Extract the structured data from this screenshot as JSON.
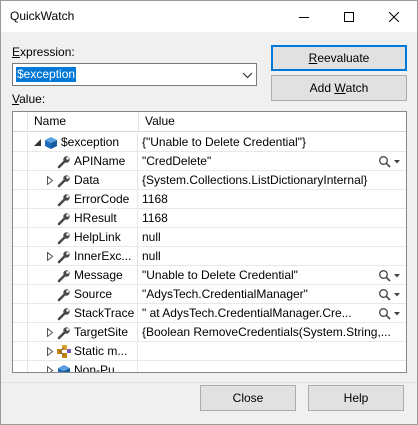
{
  "window": {
    "title": "QuickWatch"
  },
  "expression": {
    "label_prefix": "",
    "label_access": "E",
    "label_rest": "xpression:",
    "value": "$exception"
  },
  "value_label": {
    "access": "V",
    "rest": "alue:"
  },
  "buttons": {
    "reevaluate": {
      "access": "R",
      "rest": "eevaluate"
    },
    "add_watch": {
      "pre": "Add ",
      "access": "W",
      "rest": "atch"
    },
    "close": "Close",
    "help": "Help"
  },
  "grid": {
    "columns": [
      "Name",
      "Value"
    ],
    "rows": [
      {
        "name": "$exception",
        "value": "{\"Unable to Delete Credential\"}",
        "icon": "exception-object-icon",
        "expander": "expanded",
        "indent": 0,
        "visualizer": false
      },
      {
        "name": "APIName",
        "value": "\"CredDelete\"",
        "icon": "wrench-property-icon",
        "expander": "none",
        "indent": 1,
        "visualizer": true
      },
      {
        "name": "Data",
        "value": "{System.Collections.ListDictionaryInternal}",
        "icon": "wrench-property-icon",
        "expander": "collapsed",
        "indent": 1,
        "visualizer": false
      },
      {
        "name": "ErrorCode",
        "value": "1168",
        "icon": "wrench-property-icon",
        "expander": "none",
        "indent": 1,
        "visualizer": false
      },
      {
        "name": "HResult",
        "value": "1168",
        "icon": "wrench-property-icon",
        "expander": "none",
        "indent": 1,
        "visualizer": false
      },
      {
        "name": "HelpLink",
        "value": "null",
        "icon": "wrench-property-icon",
        "expander": "none",
        "indent": 1,
        "visualizer": false
      },
      {
        "name": "InnerExc...",
        "value": "null",
        "icon": "wrench-property-icon",
        "expander": "collapsed",
        "indent": 1,
        "visualizer": false
      },
      {
        "name": "Message",
        "value": "\"Unable to Delete Credential\"",
        "icon": "wrench-property-icon",
        "expander": "none",
        "indent": 1,
        "visualizer": true
      },
      {
        "name": "Source",
        "value": "\"AdysTech.CredentialManager\"",
        "icon": "wrench-property-icon",
        "expander": "none",
        "indent": 1,
        "visualizer": true
      },
      {
        "name": "StackTrace",
        "value": "\"   at AdysTech.CredentialManager.Cre...",
        "icon": "wrench-property-icon",
        "expander": "none",
        "indent": 1,
        "visualizer": true
      },
      {
        "name": "TargetSite",
        "value": "{Boolean RemoveCredentials(System.String,...",
        "icon": "wrench-property-icon",
        "expander": "collapsed",
        "indent": 1,
        "visualizer": false
      },
      {
        "name": "Static m...",
        "value": "",
        "icon": "static-members-icon",
        "expander": "collapsed",
        "indent": 1,
        "visualizer": false
      },
      {
        "name": "Non-Pu...",
        "value": "",
        "icon": "non-public-members-icon",
        "expander": "collapsed",
        "indent": 1,
        "visualizer": false
      },
      {
        "name": "",
        "value": "",
        "icon": "",
        "expander": "none",
        "indent": 1,
        "visualizer": false
      }
    ]
  },
  "colors": {
    "accent": "#0078d7",
    "wrench": "#4a4a4a",
    "object": "#1e6bb8"
  }
}
